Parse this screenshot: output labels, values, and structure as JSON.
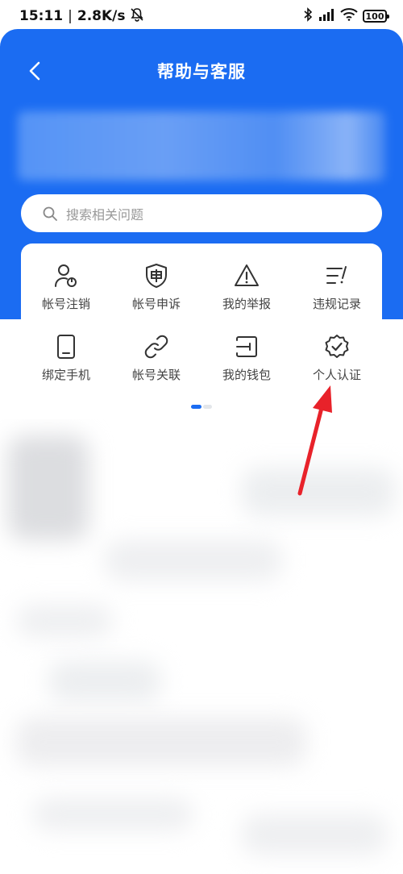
{
  "status_bar": {
    "time": "15:11",
    "network_speed": "2.8K/s",
    "battery": "100",
    "icons": [
      "mute-icon",
      "bluetooth-icon",
      "signal-icon",
      "wifi-icon",
      "battery-icon"
    ]
  },
  "header": {
    "title": "帮助与客服",
    "back_icon": "chevron-left-icon"
  },
  "search": {
    "placeholder": "搜索相关问题"
  },
  "quick_actions": [
    {
      "label": "帐号注销",
      "icon": "user-power-icon"
    },
    {
      "label": "帐号申诉",
      "icon": "shield-shen-icon"
    },
    {
      "label": "我的举报",
      "icon": "warning-triangle-icon"
    },
    {
      "label": "违规记录",
      "icon": "list-flag-icon"
    },
    {
      "label": "绑定手机",
      "icon": "phone-icon"
    },
    {
      "label": "帐号关联",
      "icon": "link-icon"
    },
    {
      "label": "我的钱包",
      "icon": "wallet-icon"
    },
    {
      "label": "个人认证",
      "icon": "verified-badge-icon"
    }
  ],
  "pager": {
    "current": 1,
    "total": 2
  },
  "colors": {
    "primary_blue": "#1b6cf2",
    "annotation_red": "#e8222a",
    "icon_dark": "#333333",
    "label_gray": "#444444"
  }
}
